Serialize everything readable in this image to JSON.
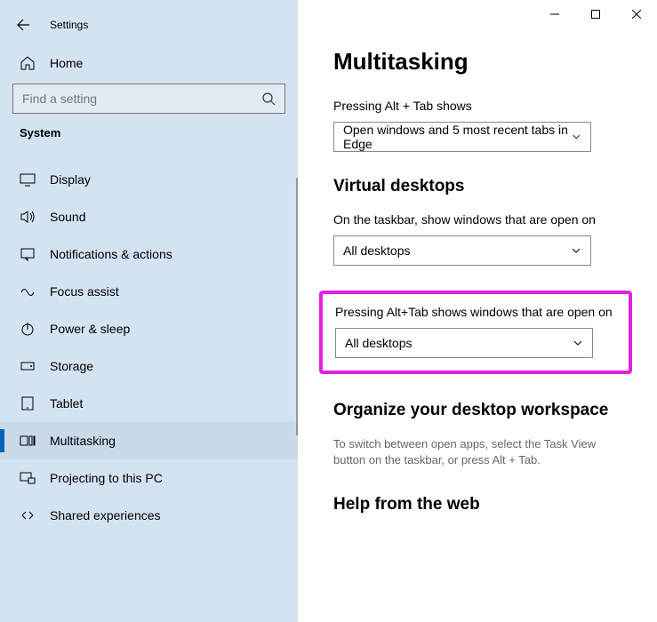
{
  "titlebar": {
    "title": "Settings"
  },
  "home": {
    "label": "Home"
  },
  "search": {
    "placeholder": "Find a setting"
  },
  "category": "System",
  "nav": [
    {
      "label": "Display"
    },
    {
      "label": "Sound"
    },
    {
      "label": "Notifications & actions"
    },
    {
      "label": "Focus assist"
    },
    {
      "label": "Power & sleep"
    },
    {
      "label": "Storage"
    },
    {
      "label": "Tablet"
    },
    {
      "label": "Multitasking"
    },
    {
      "label": "Projecting to this PC"
    },
    {
      "label": "Shared experiences"
    }
  ],
  "page": {
    "heading": "Multitasking",
    "altTab": {
      "label": "Pressing Alt + Tab shows",
      "value": "Open windows and 5 most recent tabs in Edge"
    },
    "virtualDesktops": {
      "heading": "Virtual desktops",
      "taskbar": {
        "label": "On the taskbar, show windows that are open on",
        "value": "All desktops"
      },
      "altTab": {
        "label": "Pressing Alt+Tab shows windows that are open on",
        "value": "All desktops"
      }
    },
    "organize": {
      "heading": "Organize your desktop workspace",
      "desc": "To switch between open apps, select the Task View button on the taskbar, or press Alt + Tab."
    },
    "help": {
      "heading": "Help from the web"
    }
  }
}
